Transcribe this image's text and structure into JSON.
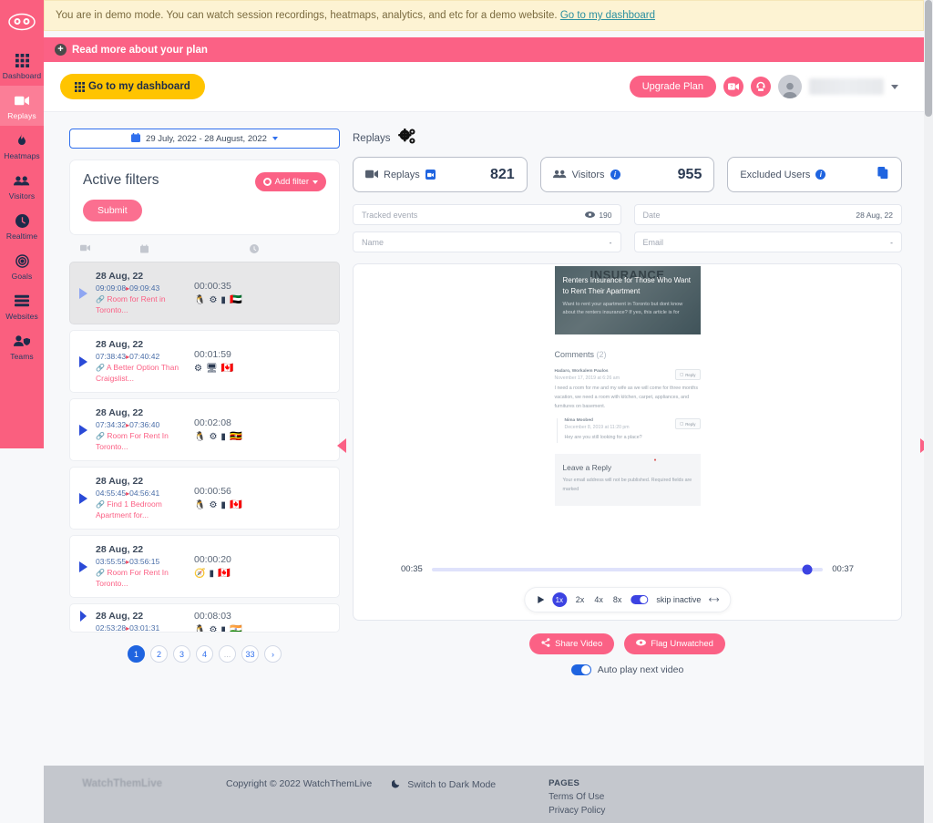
{
  "banners": {
    "demo_text": "You are in demo mode. You can watch session recordings, heatmaps, analytics, and etc for a demo website.",
    "demo_link": "Go to my dashboard",
    "plan_text": "Read more about your plan",
    "plus_glyph": "+"
  },
  "sidebar": {
    "items": [
      {
        "label": "Dashboard",
        "icon": "grid-icon",
        "active": false
      },
      {
        "label": "Replays",
        "icon": "video-camera-icon",
        "active": true
      },
      {
        "label": "Heatmaps",
        "icon": "flame-icon",
        "active": false
      },
      {
        "label": "Visitors",
        "icon": "users-icon",
        "active": false
      },
      {
        "label": "Realtime",
        "icon": "clock-icon",
        "active": false
      },
      {
        "label": "Goals",
        "icon": "target-icon",
        "active": false
      },
      {
        "label": "Websites",
        "icon": "server-icon",
        "active": false
      },
      {
        "label": "Teams",
        "icon": "user-shield-icon",
        "active": false
      }
    ]
  },
  "topbar": {
    "dashboard_button": "Go to my dashboard",
    "upgrade_button": "Upgrade Plan",
    "video_help_icon": "video-question-icon",
    "support_icon": "headset-icon",
    "avatar_icon": "user-avatar",
    "caret_icon": "chevron-down-icon"
  },
  "left": {
    "date_range": "29 July, 2022 - 28 August, 2022",
    "calendar_icon": "calendar-icon",
    "filters_title": "Active filters",
    "add_filter": "Add filter",
    "submit": "Submit",
    "columns": [
      "video-camera-icon",
      "calendar-icon",
      "clock-icon"
    ],
    "replays": [
      {
        "date": "28 Aug, 22",
        "start": "09:09:08",
        "end": "09:09:43",
        "page": "Room for Rent in Toronto...",
        "duration": "00:00:35",
        "device": "linux-icon",
        "browser": "chrome-icon",
        "platform": "mobile-icon",
        "flag": "🇦🇪",
        "selected": true
      },
      {
        "date": "28 Aug, 22",
        "start": "07:38:43",
        "end": "07:40:42",
        "page": "A Better Option Than Craigslist...",
        "duration": "00:01:59",
        "device": "",
        "browser": "chrome-icon",
        "platform": "desktop-icon",
        "flag": "🇨🇦",
        "selected": false
      },
      {
        "date": "28 Aug, 22",
        "start": "07:34:32",
        "end": "07:36:40",
        "page": "Room For Rent In Toronto...",
        "duration": "00:02:08",
        "device": "linux-icon",
        "browser": "chrome-icon",
        "platform": "mobile-icon",
        "flag": "🇺🇬",
        "selected": false
      },
      {
        "date": "28 Aug, 22",
        "start": "04:55:45",
        "end": "04:56:41",
        "page": "Find 1 Bedroom Apartment for...",
        "duration": "00:00:56",
        "device": "linux-icon",
        "browser": "chrome-icon",
        "platform": "mobile-icon",
        "flag": "🇨🇦",
        "selected": false
      },
      {
        "date": "28 Aug, 22",
        "start": "03:55:55",
        "end": "03:56:15",
        "page": "Room For Rent In Toronto...",
        "duration": "00:00:20",
        "device": "",
        "browser": "safari-icon",
        "platform": "mobile-icon",
        "flag": "🇨🇦",
        "selected": false
      },
      {
        "date": "28 Aug, 22",
        "start": "02:53:28",
        "end": "03:01:31",
        "page": "",
        "duration": "00:08:03",
        "device": "linux-icon",
        "browser": "chrome-icon",
        "platform": "mobile-icon",
        "flag": "🇮🇳",
        "selected": false
      }
    ],
    "pagination": [
      "1",
      "2",
      "3",
      "4",
      "...",
      "33"
    ],
    "pagination_active": "1",
    "pagination_next": "›"
  },
  "main": {
    "heading": "Replays",
    "gear_icon": "gears-icon",
    "stats": [
      {
        "label": "Replays",
        "value": "821",
        "icon": "video-camera-icon",
        "badge": "video-badge"
      },
      {
        "label": "Visitors",
        "value": "955",
        "icon": "users-icon",
        "badge": "info"
      },
      {
        "label": "Excluded Users",
        "value": "",
        "icon": "",
        "badge": "info",
        "action_icon": "copy-icon"
      }
    ],
    "fields": [
      {
        "label": "Tracked events",
        "value": "190",
        "icon": "eye-icon"
      },
      {
        "label": "Name",
        "value": "-",
        "icon": ""
      },
      {
        "label": "Date",
        "value": "28 Aug, 22",
        "icon": ""
      },
      {
        "label": "Email",
        "value": "-",
        "icon": ""
      }
    ]
  },
  "player": {
    "site": {
      "hero_bgword": "INSURANCE",
      "hero_title": "Renters Insurance for Those Who Want to Rent Their Apartment",
      "hero_sub": "Want to rent your apartment in Toronto but dont know about the renters insurance? If yes, this article is for",
      "comments_title": "Comments",
      "comments_count": "(2)",
      "comment1_author": "Hadaro, Workalem Paulos",
      "comment1_date": "November 17, 2019 at 6:26 am",
      "comment1_body": "I need a room for me and my wife as we will come for three months vacation, we need a room with kitchen, carpet, appliances, and furnitures on basement.",
      "comment2_author": "Nima Moobed",
      "comment2_date": "December 8, 2019 at 11:20 pm",
      "comment2_body": "Hey are you still looking for a place?",
      "reply_label": "Reply",
      "leave_reply_title": "Leave a Reply",
      "leave_reply_note": "Your email address will not be published. Required fields are marked"
    },
    "current_time": "00:35",
    "total_time": "00:37",
    "speeds": [
      "1x",
      "2x",
      "4x",
      "8x"
    ],
    "active_speed": "1x",
    "skip_inactive": "skip inactive",
    "play_icon": "play-icon",
    "expand_icon": "expand-icon",
    "prev_icon": "prev-replay-arrow",
    "next_icon": "next-replay-arrow"
  },
  "actions": {
    "share": "Share Video",
    "share_icon": "share-icon",
    "flag": "Flag Unwatched",
    "flag_icon": "eye-icon",
    "autoplay": "Auto play next video",
    "help": "?"
  },
  "footer": {
    "logo": "WatchThemLive",
    "copyright": "Copyright © 2022 WatchThemLive",
    "dark_mode": "Switch to Dark Mode",
    "moon_icon": "moon-icon",
    "pages_title": "PAGES",
    "links": [
      "Terms Of Use",
      "Privacy Policy"
    ]
  }
}
